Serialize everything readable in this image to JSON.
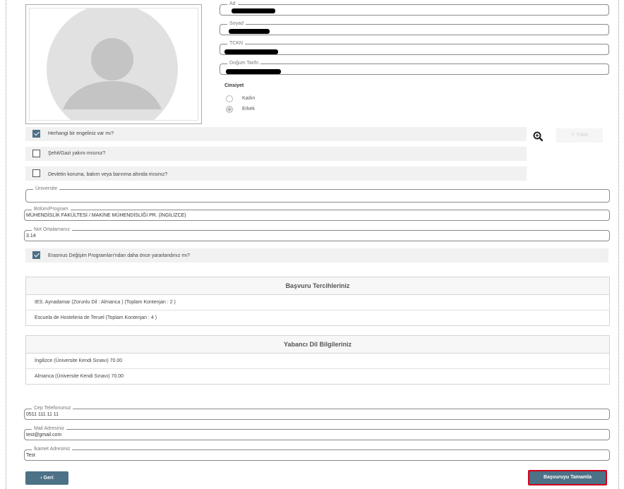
{
  "personal": {
    "ad_label": "Ad",
    "soyad_label": "Soyad",
    "tckn_label": "TCKN",
    "dogum_label": "Doğum Tarihi"
  },
  "gender": {
    "title": "Cinsiyet",
    "options": [
      "Kadın",
      "Erkek"
    ],
    "selected": "Erkek"
  },
  "checkboxes": [
    {
      "label": "Herhangi bir engeliniz var mı?",
      "checked": true
    },
    {
      "label": "Şehit/Gazi yakını mısınız?",
      "checked": false
    },
    {
      "label": "Devletin koruma, bakım veya barınma altında mısınız?",
      "checked": false
    }
  ],
  "upload_label": "Yükle",
  "university": {
    "label": "Üniversite",
    "value": ""
  },
  "department": {
    "label": "Bölüm/Program",
    "value": "MÜHENDİSLİK FAKÜLTESİ / MAKİNE MÜHENDİSLİĞİ PR. (İNGİLİZCE)"
  },
  "gpa": {
    "label": "Not Ortalamanız",
    "value": "3.14"
  },
  "erasmus": {
    "label": "Erasmus Değişim Programları'ndan daha önce yararlandınız mı?",
    "checked": true
  },
  "preferences": {
    "title": "Başvuru Tercihleriniz",
    "rows": [
      "IES. Aynadamar (Zorunlu Dil : Almanca ) (Toplam Kontenjan : 2 )",
      "Escuela de Hosteleria de Teruel (Toplam Kontenjan : 4 )"
    ]
  },
  "languages": {
    "title": "Yabancı Dil Bilgileriniz",
    "rows": [
      "İngilizce (Üniversite Kendi Sınavı) 70.00",
      "Almanca (Üniversite Kendi Sınavı) 70.00"
    ]
  },
  "contact": {
    "phone_label": "Cep Telefonunuz",
    "phone_value": "0511 111 11 11",
    "mail_label": "Mail Adresiniz",
    "mail_value": "test@gmail.com",
    "address_label": "İkamet Adresiniz",
    "address_value": "Test"
  },
  "buttons": {
    "back": "Geri",
    "complete": "Başvuruyu Tamamla"
  },
  "colors": {
    "accent": "#4d7186",
    "highlight_border": "#d0021b"
  },
  "icons": {
    "avatar": "user-avatar-placeholder",
    "zoom": "zoom-in-icon",
    "upload": "upload-icon",
    "back": "chevron-left-icon"
  }
}
